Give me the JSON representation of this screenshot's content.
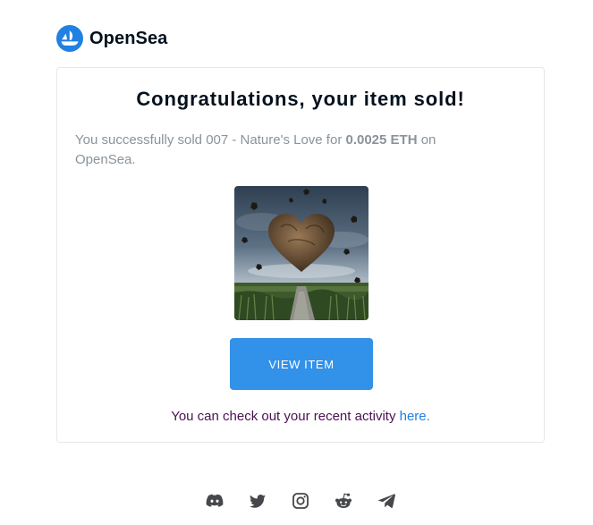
{
  "brand": {
    "name": "OpenSea",
    "color": "#2081e2"
  },
  "email": {
    "title": "Congratulations, your item sold!",
    "message": {
      "prefix": "You successfully sold ",
      "item_name": "007 - Nature's Love",
      "middle": " for ",
      "price": "0.0025 ETH",
      "suffix": " on OpenSea."
    },
    "nft_image": {
      "alt": "007 - Nature's Love",
      "depicts": "heart-shaped-rock-over-field-image"
    },
    "view_button_label": "VIEW ITEM",
    "activity": {
      "text": "You can check out your recent activity ",
      "link_label": "here."
    }
  },
  "colors": {
    "button": "#3291e9",
    "link": "#2081e2",
    "activity_text": "#4b1153",
    "muted_text": "#8a939b"
  },
  "footer": {
    "social_icons": [
      "discord-icon",
      "twitter-icon",
      "instagram-icon",
      "reddit-icon",
      "telegram-icon"
    ]
  }
}
